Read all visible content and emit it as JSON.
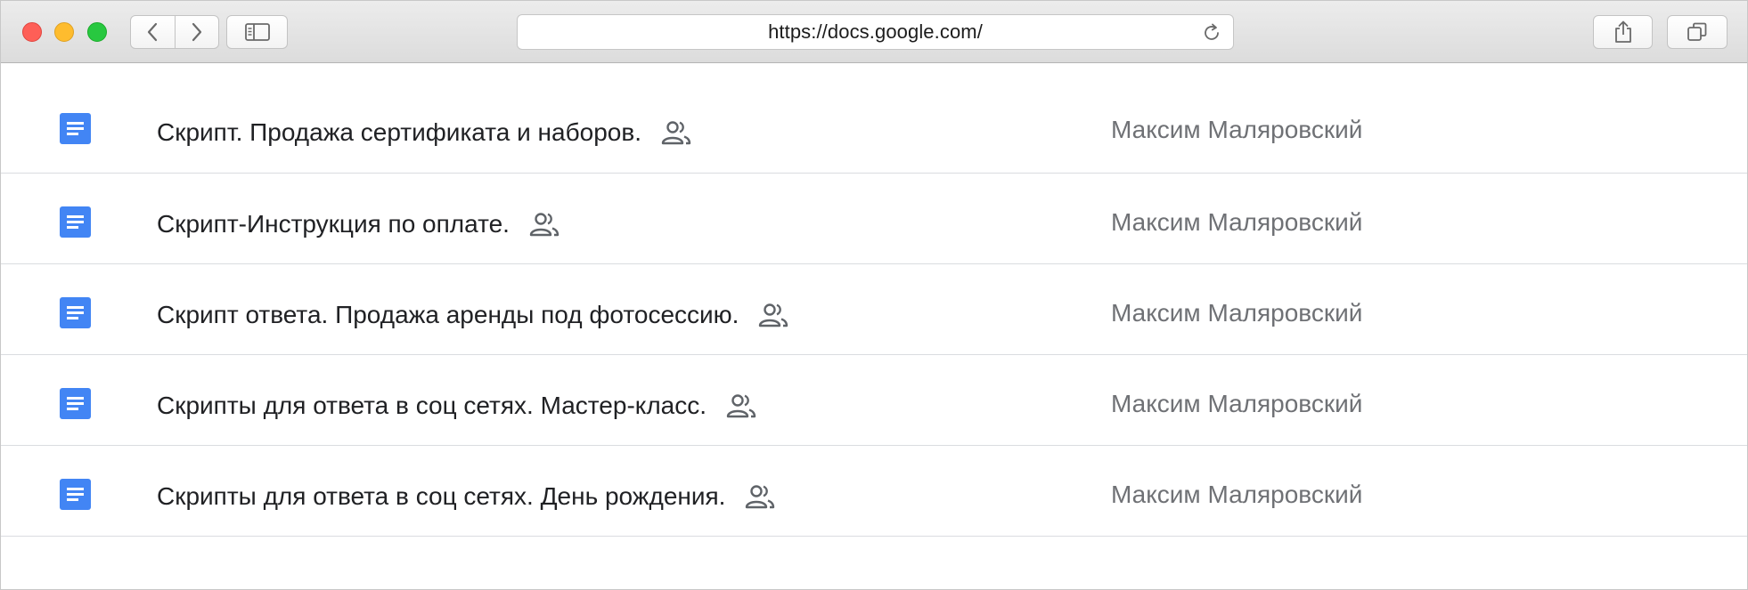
{
  "browser": {
    "url": "https://docs.google.com/",
    "traffic_lights": {
      "close": "#fe5f57",
      "minimize": "#febc2e",
      "zoom": "#28c840"
    },
    "icons": [
      "back-icon",
      "forward-icon",
      "sidebar-icon",
      "reload-icon",
      "share-icon",
      "tabs-icon"
    ]
  },
  "documents": [
    {
      "title": "Скрипт. Продажа сертификата и наборов.",
      "owner": "Максим Маляровский",
      "shared": true
    },
    {
      "title": "Скрипт-Инструкция по оплате.",
      "owner": "Максим Маляровский",
      "shared": true
    },
    {
      "title": "Скрипт ответа. Продажа аренды под фотосессию.",
      "owner": "Максим Маляровский",
      "shared": true
    },
    {
      "title": "Скрипты для ответа в соц сетях. Мастер-класс.",
      "owner": "Максим Маляровский",
      "shared": true
    },
    {
      "title": "Скрипты для ответа в соц сетях. День рождения.",
      "owner": "Максим Маляровский",
      "shared": true
    }
  ],
  "colors": {
    "doc_icon": "#4285f4",
    "owner_text": "#6f7175",
    "title_text": "#202124",
    "shared_icon": "#5f6368"
  }
}
